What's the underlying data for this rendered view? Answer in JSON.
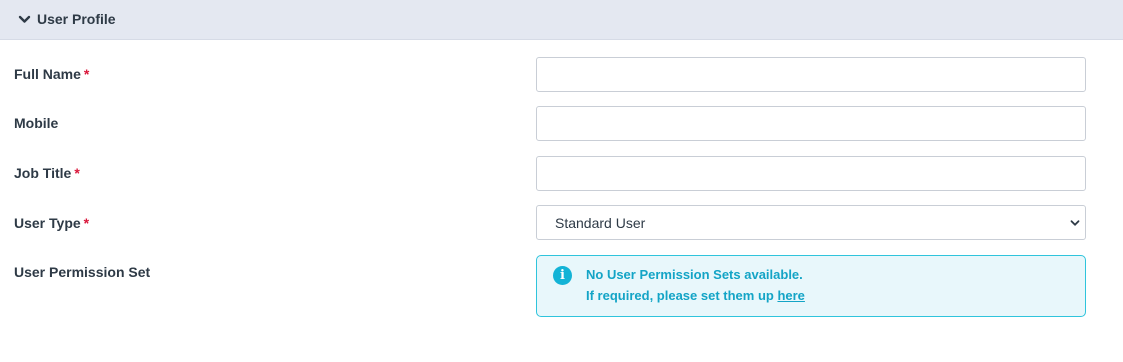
{
  "section": {
    "title": "User Profile",
    "toggle_icon": "chevron-down-icon"
  },
  "fields": {
    "full_name": {
      "label": "Full Name",
      "required_mark": "*",
      "value": ""
    },
    "mobile": {
      "label": "Mobile",
      "value": ""
    },
    "job_title": {
      "label": "Job Title",
      "required_mark": "*",
      "value": ""
    },
    "user_type": {
      "label": "User Type",
      "required_mark": "*",
      "selected": "Standard User",
      "caret_icon": "chevron-down-icon"
    },
    "permission_set": {
      "label": "User Permission Set",
      "info_icon": "info-icon",
      "message_line1": "No User Permission Sets available.",
      "message_line2_prefix": "If required, please set them up",
      "message_link": "here"
    }
  },
  "colors": {
    "header_bg": "#e4e8f1",
    "required": "#d9163a",
    "info_accent": "#13a4c6",
    "info_bg": "#e8f7fb"
  }
}
